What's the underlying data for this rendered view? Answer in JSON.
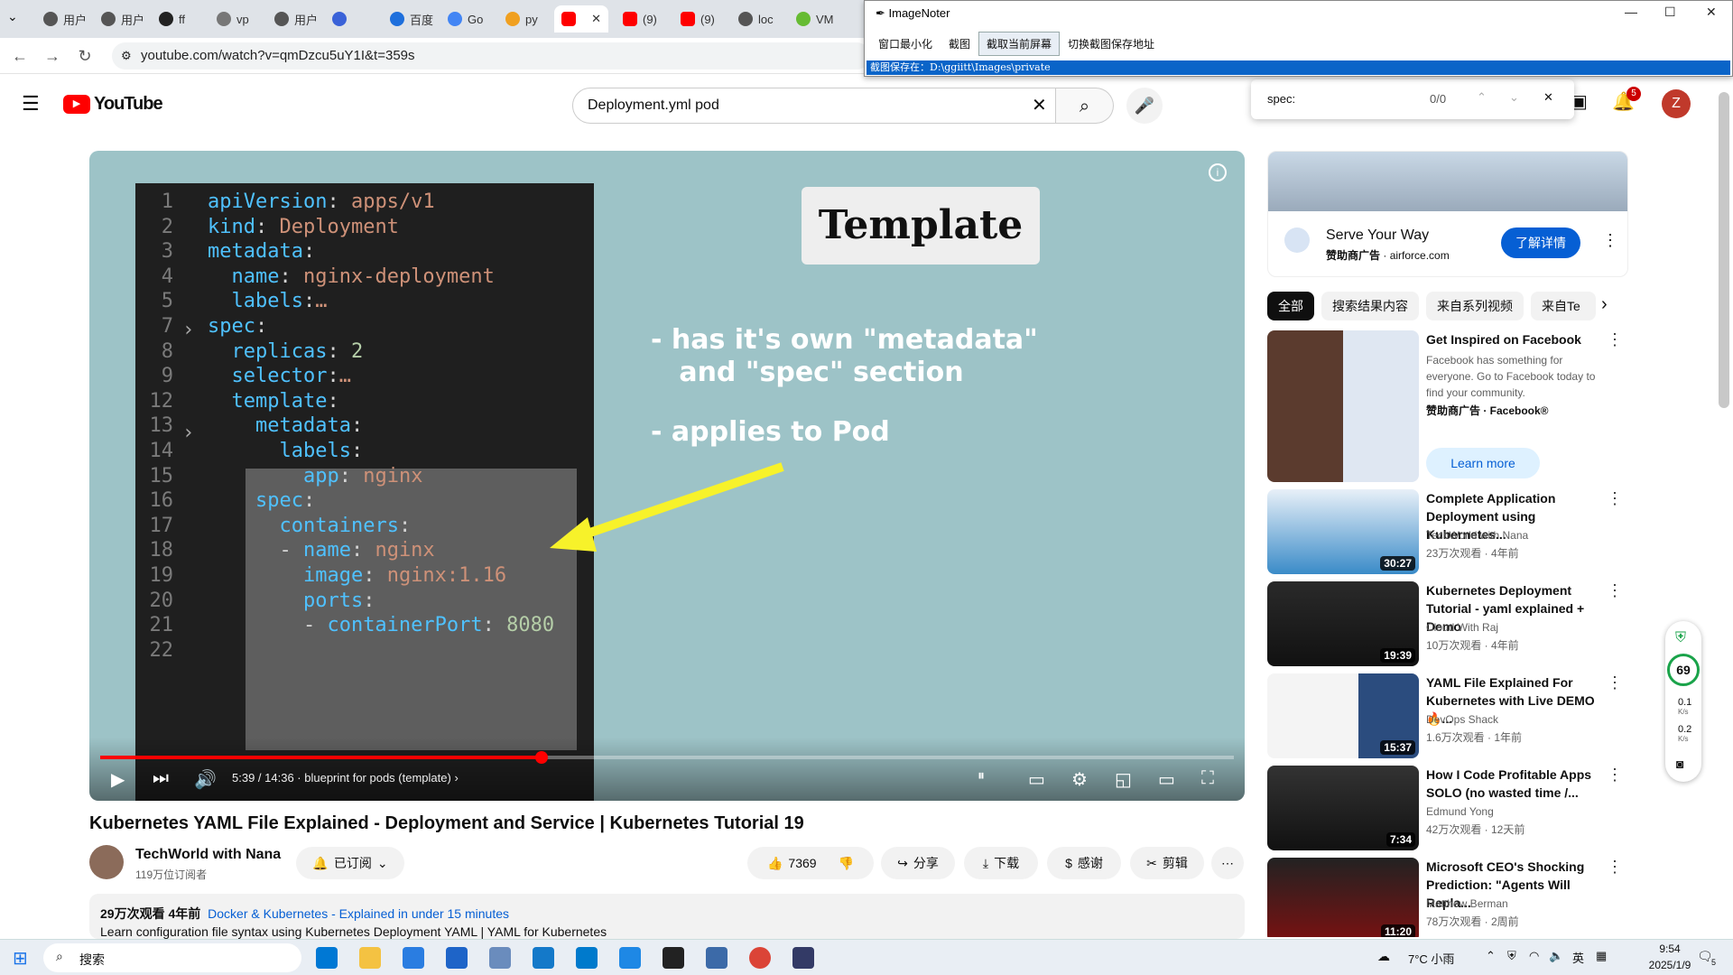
{
  "browser": {
    "tabs": [
      "用户",
      "用户",
      "ff",
      "vp",
      "用户",
      "",
      "百度",
      "Go",
      "py",
      "",
      "(9)",
      "(9)",
      "loc",
      "VM"
    ],
    "url": "youtube.com/watch?v=qmDzcu5uY1I&t=359s"
  },
  "imagenoter": {
    "title": "ImageNoter",
    "menu": [
      "窗口最小化",
      "截图",
      "截取当前屏幕",
      "切换截图保存地址"
    ],
    "save_path": "截图保存在：D:\\ggiitt\\Images\\private"
  },
  "findbar": {
    "query": "spec:",
    "count": "0/0"
  },
  "youtube": {
    "logo": "YouTube",
    "search_value": "Deployment.yml pod",
    "notifications": "5",
    "avatar_letter": "Z"
  },
  "video": {
    "code_lines": [
      {
        "n": "1",
        "text": "apiVersion: apps/v1"
      },
      {
        "n": "2",
        "text": "kind: Deployment"
      },
      {
        "n": "3",
        "text": "metadata:"
      },
      {
        "n": "4",
        "text": "  name: nginx-deployment"
      },
      {
        "n": "5",
        "text": "  labels:…"
      },
      {
        "n": "7",
        "text": "spec:"
      },
      {
        "n": "8",
        "text": "  replicas: 2"
      },
      {
        "n": "9",
        "text": "  selector:…"
      },
      {
        "n": "12",
        "text": "  template:"
      },
      {
        "n": "13",
        "text": "    metadata:"
      },
      {
        "n": "14",
        "text": "      labels:"
      },
      {
        "n": "15",
        "text": "        app: nginx"
      },
      {
        "n": "16",
        "text": "    spec:"
      },
      {
        "n": "17",
        "text": "      containers:"
      },
      {
        "n": "18",
        "text": "      - name: nginx"
      },
      {
        "n": "19",
        "text": "        image: nginx:1.16"
      },
      {
        "n": "20",
        "text": "        ports:"
      },
      {
        "n": "21",
        "text": "        - containerPort: 8080"
      },
      {
        "n": "22",
        "text": ""
      }
    ],
    "slide_title": "Template",
    "bullet1": "- has it's own \"metadata\"\n   and \"spec\" section",
    "bullet2": "- applies to Pod",
    "time": "5:39 / 14:36",
    "chapter": "blueprint for pods (template)",
    "progress": 0.389
  },
  "meta": {
    "title": "Kubernetes YAML File Explained - Deployment and Service | Kubernetes Tutorial 19",
    "channel": "TechWorld with Nana",
    "subs": "119万位订阅者",
    "subscribed": "已订阅",
    "likes": "7369",
    "share": "分享",
    "download": "下载",
    "thanks": "感谢",
    "clip": "剪辑",
    "desc_stats": "29万次观看  4年前",
    "desc_tags": "Docker & Kubernetes - Explained in under 15 minutes",
    "desc_line": "Learn configuration file syntax using Kubernetes Deployment YAML | YAML for Kubernetes"
  },
  "sidebar": {
    "ad": {
      "title": "Serve Your Way",
      "label": "赞助商广告",
      "domain": "airforce.com",
      "cta": "了解详情"
    },
    "chips": [
      "全部",
      "搜索结果内容",
      "来自系列视频",
      "来自Te"
    ],
    "recs": [
      {
        "title": "Get Inspired on Facebook",
        "desc": "Facebook has something for everyone. Go to Facebook today to find your community.",
        "channel": "赞助商广告 · Facebook®",
        "meta": "",
        "duration": "",
        "cta": "Learn more"
      },
      {
        "title": "Complete Application Deployment using Kubernetes...",
        "channel": "TechWorld with Nana",
        "meta": "23万次观看 · 4年前",
        "duration": "30:27"
      },
      {
        "title": "Kubernetes Deployment Tutorial - yaml explained + Demo",
        "channel": "Cloud With Raj",
        "meta": "10万次观看 · 4年前",
        "duration": "19:39"
      },
      {
        "title": "YAML File Explained For Kubernetes with Live DEMO🔥...",
        "channel": "DevOps Shack",
        "meta": "1.6万次观看 · 1年前",
        "duration": "15:37"
      },
      {
        "title": "How I Code Profitable Apps SOLO (no wasted time /...",
        "channel": "Edmund Yong",
        "meta": "42万次观看 · 12天前",
        "duration": "7:34"
      },
      {
        "title": "Microsoft CEO's Shocking Prediction: \"Agents Will Repla...",
        "channel": "Matthew Berman",
        "meta": "78万次观看 · 2周前",
        "duration": "11:20"
      }
    ]
  },
  "widget": {
    "percent": "69",
    "up": "0.1",
    "down": "0.2",
    "unit": "K/s"
  },
  "taskbar": {
    "search": "搜索",
    "weather": "7°C 小雨",
    "ime": "英",
    "time": "9:54",
    "date": "2025/1/9",
    "badge": "5"
  }
}
